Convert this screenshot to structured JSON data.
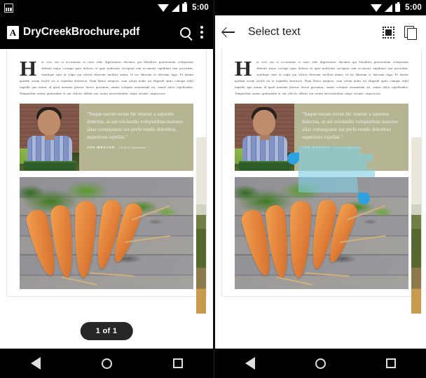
{
  "left": {
    "statusbar": {
      "notification_icon": "screenshot-icon",
      "wifi_icon": "wifi-icon",
      "signal_icon": "signal-icon",
      "battery_icon": "battery-icon",
      "time": "5:00"
    },
    "appbar": {
      "file_icon": "pdf-file-icon",
      "title": "DryCreekBrochure.pdf",
      "search_icon": "search-icon",
      "overflow_icon": "more-vert-icon"
    },
    "page_indicator": "1 of 1"
  },
  "right": {
    "statusbar": {
      "wifi_icon": "wifi-icon",
      "signal_icon": "signal-icon",
      "battery_icon": "battery-icon",
      "time": "5:00"
    },
    "appbar": {
      "back_icon": "back-arrow-icon",
      "title": "Select text",
      "select_all_icon": "select-all-icon",
      "copy_icon": "copy-icon"
    },
    "selection": {
      "handle_start": "selection-handle-start",
      "handle_end": "selection-handle-end",
      "highlight_color": "#7fcfe0",
      "handle_color": "#2aa3e0"
    }
  },
  "document": {
    "dropcap": "H",
    "body": "at vero eos et accusamus et iusto odio dignissimos ducimus qui blanditiis praesentium voluptatum deleniti atque corrupti quos dolores et quas molestias excepturi sint occaecati cupiditate non provident, similique sunt in culpa qui officia deserunt mollitia animi, id est laborum et dolorum fuga. Et harum quidem rerum facilis est et expedita distinctio. Nam libero tempore, cum soluta nobis est eligendi optio cumque nihil impedit quo minus id quod maxime placeat facere possimus, omnis voluptas assumenda est, omnis dolor repellendus. Temporibus autem quibusdam et aut officiis debitis aut rerum necessitatibus saepe eveniet caspericres.",
    "quote": "\"Itaque earum rerum hic tenetur a sapiente delectus, ut aut reiciendis voluptatibus maiores alias consequatur aut perfe rendis doloribus asperiores repellat.\"",
    "quote_author": "JON WESTON",
    "quote_role": "Chief of Operations",
    "portrait_alt": "portrait-photo",
    "carrots_alt": "carrots-photo",
    "quote_bg_color": "#b5b593"
  },
  "navbar": {
    "back_icon": "nav-back-icon",
    "home_icon": "nav-home-icon",
    "recents_icon": "nav-recents-icon"
  }
}
